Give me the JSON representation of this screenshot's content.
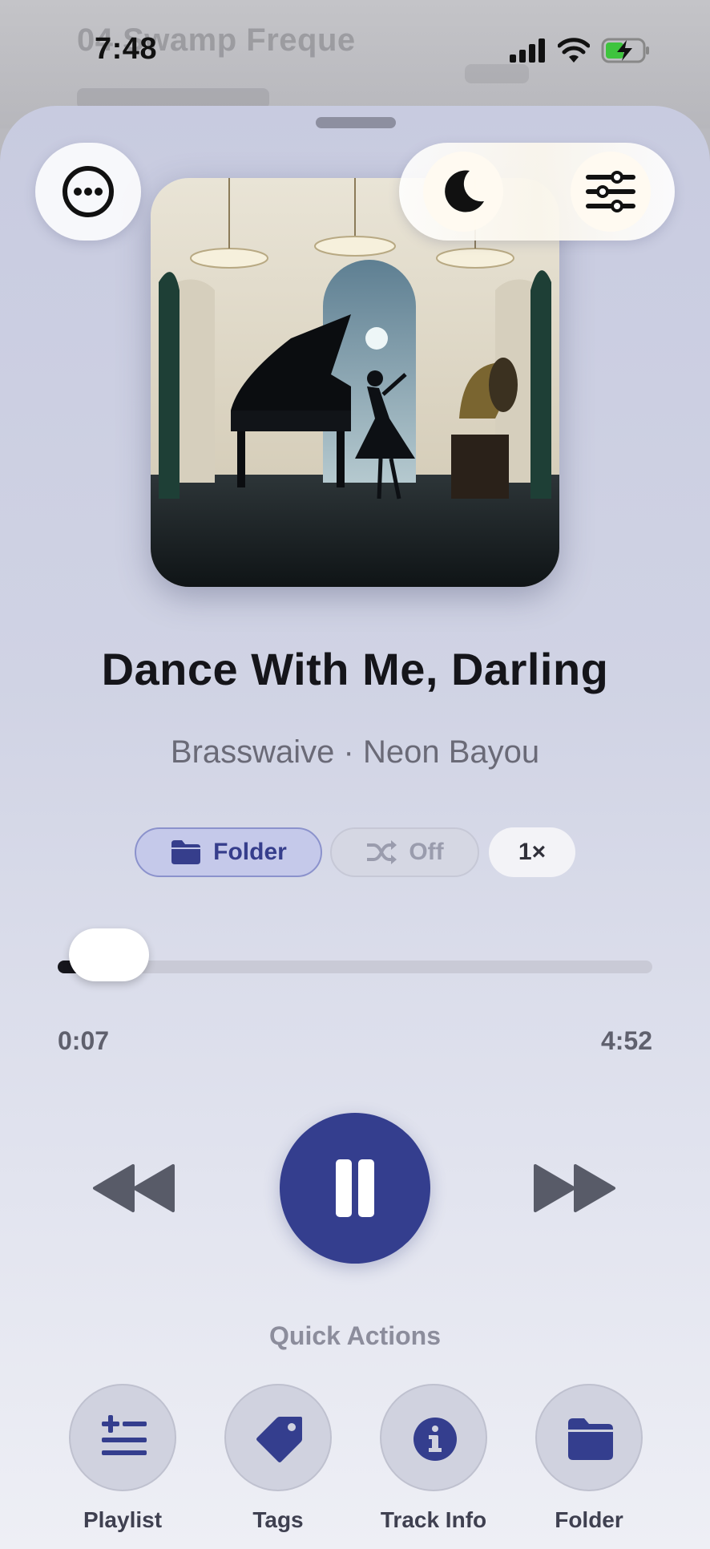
{
  "status_bar": {
    "time": "7:48"
  },
  "background": {
    "title": "04 Swamp Freque"
  },
  "sheet": {
    "top_bar": {
      "more": "ellipsis-icon",
      "sleep": "moon-icon",
      "settings": "sliders-icon"
    }
  },
  "track": {
    "title": "Dance With Me, Darling",
    "subtitle": "Brasswaive · Neon Bayou"
  },
  "chips": {
    "folder": "Folder",
    "shuffle": "Off",
    "speed": "1×"
  },
  "progress": {
    "current": "0:07",
    "duration": "4:52",
    "fraction": 0.024
  },
  "controls": {
    "rewind": "rewind-icon",
    "play": "pause-icon",
    "forward": "fast-forward-icon"
  },
  "quick_actions": {
    "label": "Quick Actions",
    "items": [
      {
        "label": "Playlist",
        "icon": "playlist-add-icon"
      },
      {
        "label": "Tags",
        "icon": "tag-icon"
      },
      {
        "label": "Track Info",
        "icon": "info-icon"
      },
      {
        "label": "Folder",
        "icon": "folder-icon"
      }
    ]
  },
  "colors": {
    "accent": "#343e8e",
    "text": "#15151a",
    "muted": "#6a6a77"
  }
}
